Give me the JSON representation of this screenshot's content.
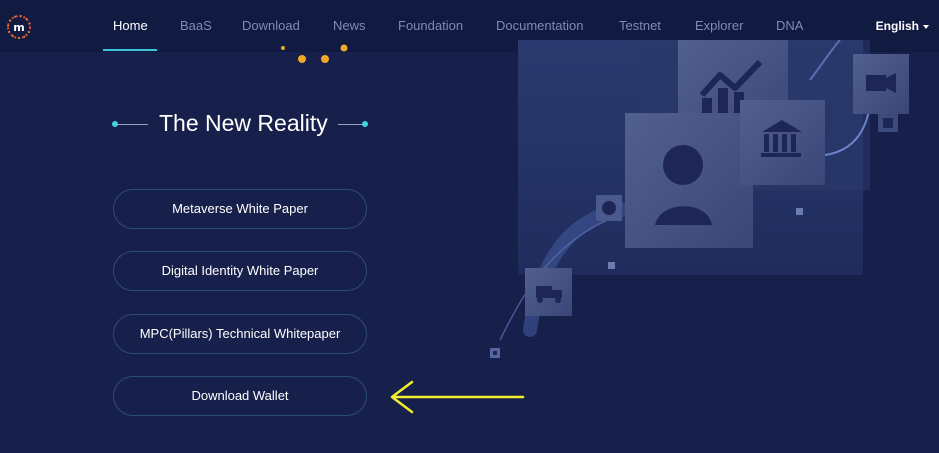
{
  "nav": {
    "items": [
      {
        "label": "Home",
        "active": true
      },
      {
        "label": "BaaS"
      },
      {
        "label": "Download"
      },
      {
        "label": "News"
      },
      {
        "label": "Foundation"
      },
      {
        "label": "Documentation"
      },
      {
        "label": "Testnet"
      },
      {
        "label": "Explorer"
      },
      {
        "label": "DNA"
      }
    ],
    "language": "English",
    "logo_icon": "m-logo-icon"
  },
  "hero": {
    "title": "The New Reality",
    "buttons": {
      "metaverse": "Metaverse White Paper",
      "digital_identity": "Digital Identity White Paper",
      "mpc": "MPC(Pillars) Technical Whitepaper",
      "download_wallet": "Download Wallet"
    }
  },
  "colors": {
    "background": "#16204a",
    "nav_background": "#111a40",
    "accent": "#39c6d8",
    "button_border": "#2d4c7c",
    "annotation_arrow": "#f2ee2e",
    "orange_dots": "#f2a62a"
  }
}
